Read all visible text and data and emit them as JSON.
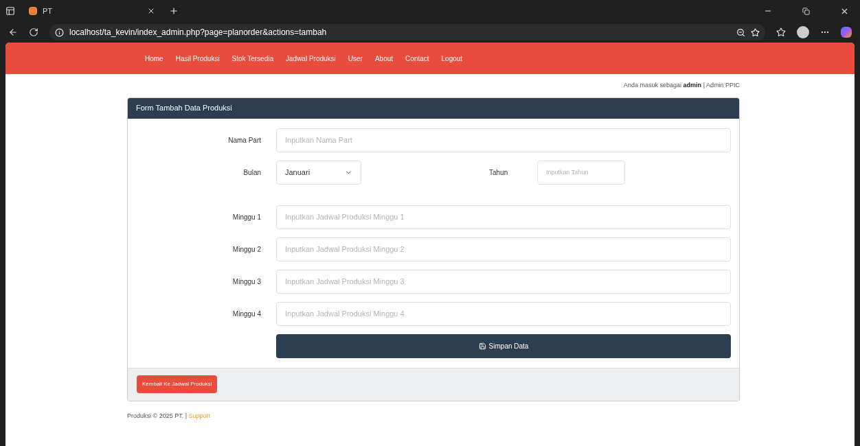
{
  "browser": {
    "tab_title": "PT",
    "url": "localhost/ta_kevin/index_admin.php?page=planorder&actions=tambah"
  },
  "nav": [
    {
      "label": "Home"
    },
    {
      "label": "Hasil Produksi"
    },
    {
      "label": "Stok Tersedia"
    },
    {
      "label": "Jadwal Produksi"
    },
    {
      "label": "User"
    },
    {
      "label": "About"
    },
    {
      "label": "Contact"
    },
    {
      "label": "Logout"
    }
  ],
  "login_info": {
    "prefix": "Anda masuk sebagai",
    "user": "admin",
    "role": "| Admin PPIC"
  },
  "form": {
    "title": "Form Tambah Data Produksi",
    "nama_part": {
      "label": "Nama Part",
      "placeholder": "Inputkan Nama Part"
    },
    "bulan": {
      "label": "Bulan",
      "value": "Januari"
    },
    "tahun": {
      "label": "Tahun",
      "placeholder": "Inputkan Tahun"
    },
    "weeks": [
      {
        "label": "Minggu 1",
        "placeholder": "Inputkan Jadwal Produksi Minggu 1"
      },
      {
        "label": "Minggu 2",
        "placeholder": "Inputkan Jadwal Produksi Minggu 2"
      },
      {
        "label": "Minggu 3",
        "placeholder": "Inputkan Jadwal Produksi Minggu 3"
      },
      {
        "label": "Minggu 4",
        "placeholder": "Inputkan Jadwal Produksi Minggu 4"
      }
    ],
    "submit": "Simpan Data",
    "back": "Kembali Ke Jadwal Produksi"
  },
  "footer": {
    "text": "Produksi © 2025 PT. |",
    "link": "Support"
  }
}
